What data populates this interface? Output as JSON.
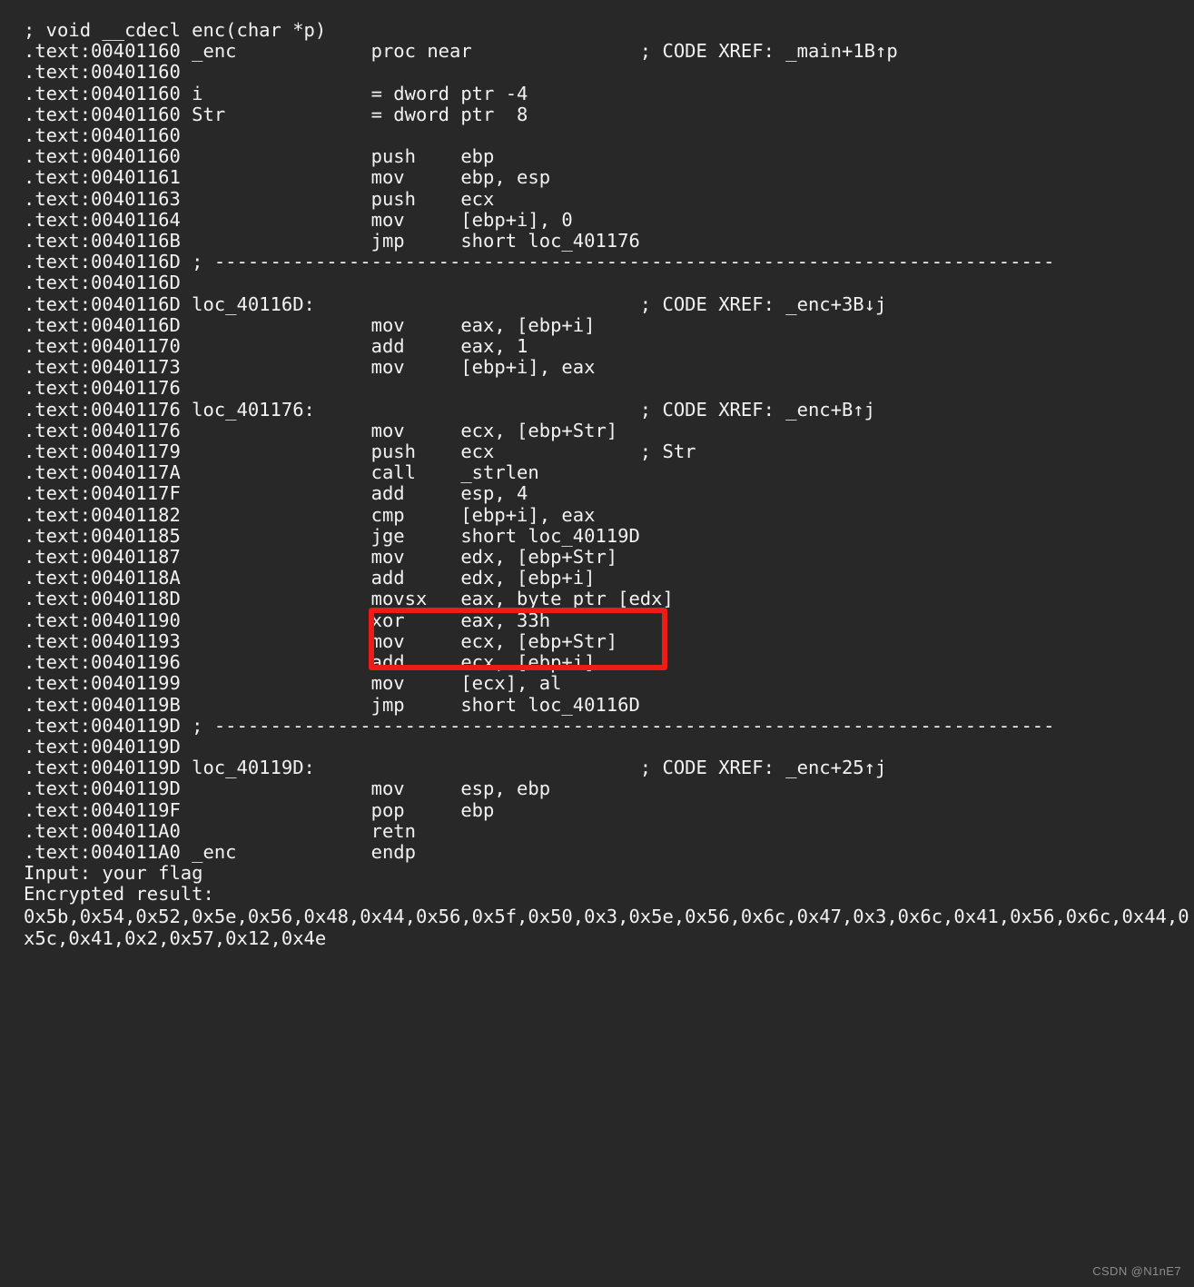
{
  "window": {
    "background_color": "#282828",
    "text_color": "#f2f2f2",
    "highlight_color": "#ee1c17"
  },
  "listing": {
    "lines": [
      "; void __cdecl enc(char *p)",
      ".text:00401160 _enc            proc near               ; CODE XREF: _main+1B↑p",
      ".text:00401160",
      ".text:00401160 i               = dword ptr -4",
      ".text:00401160 Str             = dword ptr  8",
      ".text:00401160",
      ".text:00401160                 push    ebp",
      ".text:00401161                 mov     ebp, esp",
      ".text:00401163                 push    ecx",
      ".text:00401164                 mov     [ebp+i], 0",
      ".text:0040116B                 jmp     short loc_401176",
      ".text:0040116D ; ---------------------------------------------------------------------------",
      ".text:0040116D",
      ".text:0040116D loc_40116D:                             ; CODE XREF: _enc+3B↓j",
      ".text:0040116D                 mov     eax, [ebp+i]",
      ".text:00401170                 add     eax, 1",
      ".text:00401173                 mov     [ebp+i], eax",
      ".text:00401176",
      ".text:00401176 loc_401176:                             ; CODE XREF: _enc+B↑j",
      ".text:00401176                 mov     ecx, [ebp+Str]",
      ".text:00401179                 push    ecx             ; Str",
      ".text:0040117A                 call    _strlen",
      ".text:0040117F                 add     esp, 4",
      ".text:00401182                 cmp     [ebp+i], eax",
      ".text:00401185                 jge     short loc_40119D",
      ".text:00401187                 mov     edx, [ebp+Str]",
      ".text:0040118A                 add     edx, [ebp+i]",
      ".text:0040118D                 movsx   eax, byte ptr [edx]",
      ".text:00401190                 xor     eax, 33h",
      ".text:00401193                 mov     ecx, [ebp+Str]",
      ".text:00401196                 add     ecx, [ebp+i]",
      ".text:00401199                 mov     [ecx], al",
      ".text:0040119B                 jmp     short loc_40116D",
      ".text:0040119D ; ---------------------------------------------------------------------------",
      ".text:0040119D",
      ".text:0040119D loc_40119D:                             ; CODE XREF: _enc+25↑j",
      ".text:0040119D                 mov     esp, ebp",
      ".text:0040119F                 pop     ebp",
      ".text:004011A0                 retn",
      ".text:004011A0 _enc            endp"
    ],
    "program_output": {
      "input_prompt": "Input: your flag",
      "result_label": "Encrypted result:",
      "encrypted_bytes": "0x5b,0x54,0x52,0x5e,0x56,0x48,0x44,0x56,0x5f,0x50,0x3,0x5e,0x56,0x6c,0x47,0x3,0x6c,0x41,0x56,0x6c,0x44,0x5c,0x41,0x2,0x57,0x12,0x4e"
    }
  },
  "annotation": {
    "highlight_label": "xor-highlight-box",
    "highlighted_instructions": [
      "movsx   eax, byte ptr [edx]",
      "xor     eax, 33h",
      "mov     ecx, [ebp+Str]"
    ]
  },
  "watermark": {
    "text": "CSDN @N1nE7"
  }
}
